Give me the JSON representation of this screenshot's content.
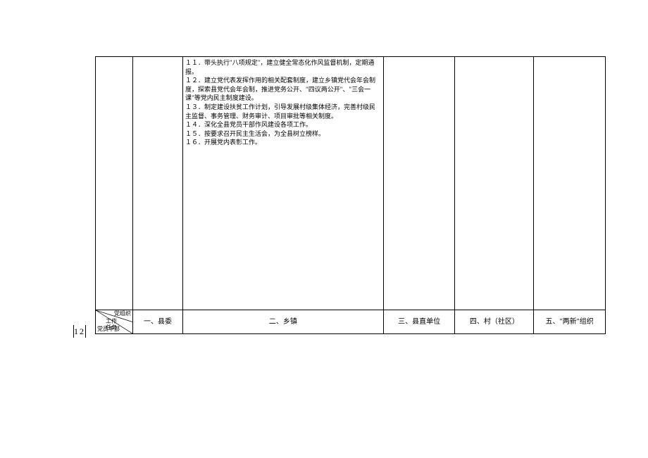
{
  "content_items": [
    "１１．带头执行\"八项规定\"，建立健全常态化作风监督机制，定期通报。",
    "１２．建立党代表发挥作用的相关配套制度，建立乡镇党代会年会制度，探索县党代会年会制，推进党务公开、\"四议两公开\"、\"三会一课\"等党内民主制度建设。",
    "１３．制定建设扶贫工作计划，引导发展村级集体经济，完善村级民主监督、事务管理、财务审计、项目审批等相关制度。",
    "１４．深化全县党员干部作风建设各项工作。",
    "１５．按要求召开民主生活会，为全县树立榜样。",
    "１６．开展党内表彰工作。"
  ],
  "corner": {
    "top": "党组织",
    "mid": "工作\n任务",
    "bot": "党员干部"
  },
  "headers": {
    "col1": "一、县委",
    "col2": "二、乡镇",
    "col3": "三、县直单位",
    "col4": "四、村（社区）",
    "col5": "五、\"两新\"组织"
  },
  "page_number": "12"
}
